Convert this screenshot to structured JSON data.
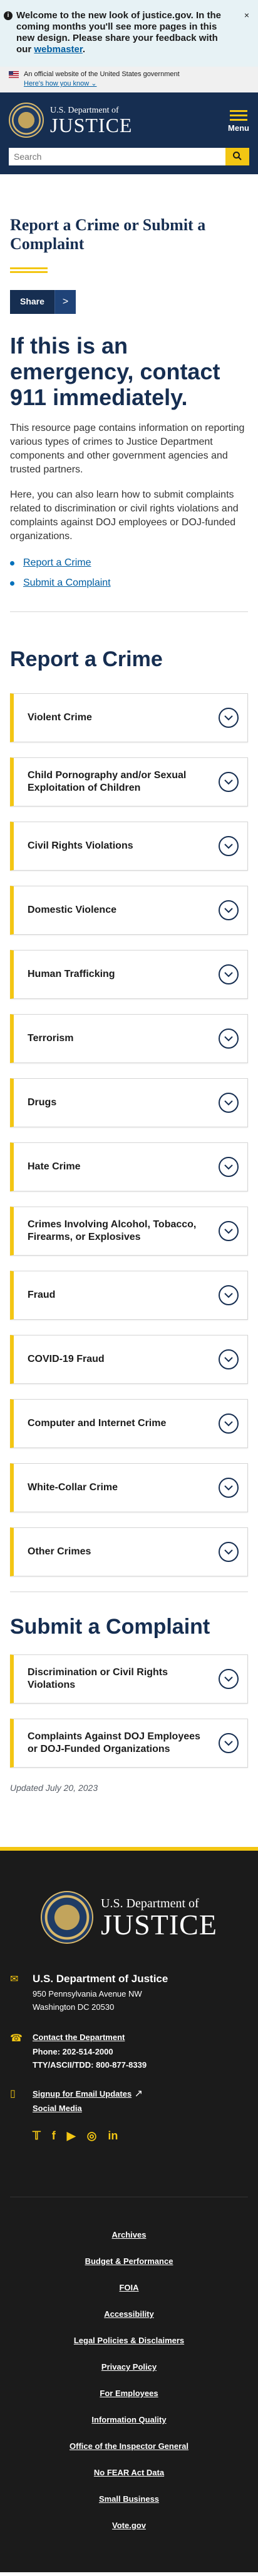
{
  "welcome": {
    "text": "Welcome to the new look of justice.gov. In the coming months you'll see more pages in this new design. Please share your feedback with our",
    "link": "webmaster",
    "suffix": ".",
    "close": "×"
  },
  "govbanner": {
    "text": "An official website of the United States government",
    "how": "Here's how you know ⌄"
  },
  "header": {
    "dept": "U.S. Department of",
    "name": "JUSTICE",
    "menu_label": "Menu",
    "search_placeholder": "Search"
  },
  "main": {
    "title": "Report a Crime or Submit a Complaint",
    "share_label": "Share",
    "share_arrow": ">",
    "emergency": "If this is an emergency, contact 911 immediately.",
    "para1": "This resource page contains information on reporting various types of crimes to Justice Department components and other government agencies and trusted partners.",
    "para2": "Here, you can also learn how to submit complaints related to discrimination or civil rights violations and complaints against DOJ employees or DOJ-funded organizations.",
    "bullets": [
      "Report a Crime",
      "Submit a Complaint"
    ],
    "report_heading": "Report a Crime",
    "report_items": [
      "Violent Crime",
      "Child Pornography and/or Sexual Exploitation of Children",
      "Civil Rights Violations",
      "Domestic Violence",
      "Human Trafficking",
      "Terrorism",
      "Drugs",
      "Hate Crime",
      "Crimes Involving Alcohol, Tobacco, Firearms, or Explosives",
      "Fraud",
      "COVID-19 Fraud",
      "Computer and Internet Crime",
      "White-Collar Crime",
      "Other Crimes"
    ],
    "complaint_heading": "Submit a Complaint",
    "complaint_items": [
      "Discrimination or Civil Rights Violations",
      "Complaints Against DOJ Employees or DOJ-Funded Organizations"
    ],
    "updated": "Updated July 20, 2023"
  },
  "footer": {
    "dept": "U.S. Department of",
    "name": "JUSTICE",
    "address_title": "U.S. Department of Justice",
    "address1": "950 Pennsylvania Avenue NW",
    "address2": "Washington DC 20530",
    "contact_link": "Contact the Department",
    "phone": "Phone: 202-514-2000",
    "tty": "TTY/ASCII/TDD: 800-877-8339",
    "email_updates": "Signup for Email Updates",
    "social_media": "Social Media",
    "links": [
      "Archives",
      "Budget & Performance",
      "FOIA",
      "Accessibility",
      "Legal Policies & Disclaimers",
      "Privacy Policy",
      "For Employees",
      "Information Quality",
      "Office of the Inspector General",
      "No FEAR Act Data",
      "Small Business",
      "Vote.gov"
    ]
  },
  "colors": {
    "navy": "#162e51",
    "gold": "#f3c613",
    "link": "#005ea2"
  }
}
